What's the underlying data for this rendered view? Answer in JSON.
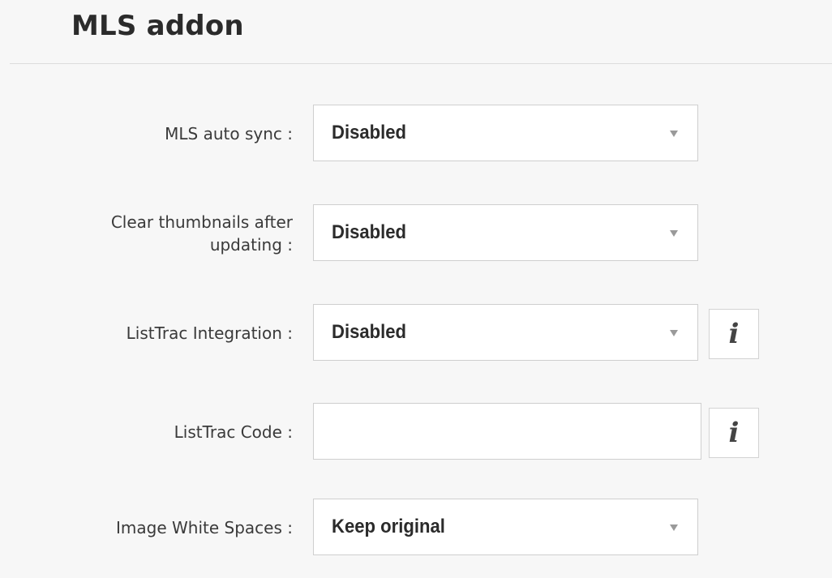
{
  "header": {
    "title": "MLS addon"
  },
  "fields": {
    "mls_auto_sync": {
      "label": "MLS auto sync :",
      "value": "Disabled"
    },
    "clear_thumbnails": {
      "label": "Clear thumbnails after\nupdating :",
      "value": "Disabled"
    },
    "listtrac_integration": {
      "label": "ListTrac Integration :",
      "value": "Disabled",
      "info_icon": "i"
    },
    "listtrac_code": {
      "label": "ListTrac Code :",
      "value": "",
      "info_icon": "i"
    },
    "image_white_spaces": {
      "label": "Image White Spaces :",
      "value": "Keep original"
    }
  },
  "colors": {
    "background": "#f7f7f7",
    "field_border": "#cfcfcf",
    "text": "#333333"
  }
}
